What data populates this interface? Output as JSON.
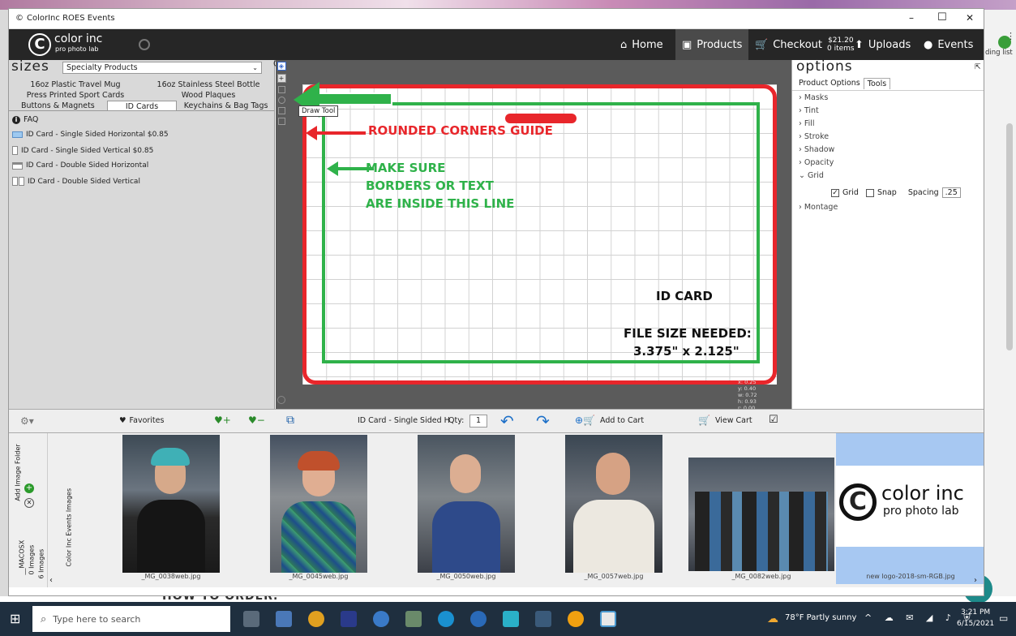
{
  "window": {
    "title": "ColorInc ROES Events",
    "controls": [
      "–",
      "☐",
      "✕"
    ]
  },
  "browser_bg": {
    "right_text": "ding list",
    "below_text": "HOW TO ORDER:"
  },
  "appbar": {
    "logo_main": "color inc",
    "logo_sub": "pro photo lab",
    "home": "Home",
    "products": "Products",
    "checkout": "Checkout",
    "cart_price": "$21.20",
    "cart_items": "0 items",
    "uploads": "Uploads",
    "events": "Events"
  },
  "left": {
    "heading": "sizes",
    "category": "Specialty Products",
    "tabs_row1": [
      "16oz Plastic Travel Mug",
      "16oz Stainless Steel Bottle"
    ],
    "tabs_row2": [
      "Press Printed Sport Cards",
      "Wood Plaques"
    ],
    "tabs_row3": [
      "Buttons & Magnets",
      "ID Cards",
      "Keychains & Bag Tags"
    ],
    "faq": "FAQ",
    "products": [
      "ID Card - Single Sided Horizontal $0.85",
      "ID Card - Single Sided Vertical $0.85",
      "ID Card - Double Sided Horizontal",
      "ID Card - Double Sided Vertical"
    ]
  },
  "canvas": {
    "tooltip": "Draw Tool",
    "rounded_guide": "ROUNDED CORNERS GUIDE",
    "borders_line1": "MAKE SURE",
    "borders_line2": "BORDERS OR TEXT",
    "borders_line3": "ARE INSIDE THIS LINE",
    "card_label": "ID CARD",
    "file_size_label": "FILE SIZE NEEDED:",
    "file_size_value": "3.375\" x 2.125\"",
    "readout": [
      "x: 0.25",
      "y: 0.40",
      "w: 0.72",
      "h: 0.93",
      "r: 0.00"
    ],
    "colors": {
      "red": "#e8262b",
      "green": "#2fb24a",
      "text_green": "#2fb24a"
    }
  },
  "options": {
    "heading": "options",
    "tabs": [
      "Product Options",
      "Tools"
    ],
    "items": [
      "Masks",
      "Tint",
      "Fill",
      "Stroke",
      "Shadow",
      "Opacity",
      "Grid",
      "Montage"
    ],
    "grid_label": "Grid",
    "snap_label": "Snap",
    "spacing_label": "Spacing",
    "spacing_value": ".25"
  },
  "toolbar": {
    "favorites": "Favorites",
    "product_name": "ID Card - Single Sided H",
    "qty_label": "Qty:",
    "qty_value": "1",
    "add_to_cart": "Add to Cart",
    "view_cart": "View Cart"
  },
  "images": {
    "add_folder": "Add Image Folder",
    "folder1_name": "__MACOSX",
    "folder1_count": "0 Images",
    "folder2_name": "Color Inc Events Images",
    "folder2_count": "6 Images",
    "files": [
      "_MG_0038web.jpg",
      "_MG_0045web.jpg",
      "_MG_0050web.jpg",
      "_MG_0057web.jpg",
      "_MG_0082web.jpg",
      "new logo-2018-sm-RGB.jpg"
    ],
    "logo_main": "color inc",
    "logo_sub": "pro photo lab"
  },
  "taskbar": {
    "search_placeholder": "Type here to search",
    "weather": "78°F  Partly sunny",
    "time": "3:21 PM",
    "date": "6/15/2021"
  }
}
